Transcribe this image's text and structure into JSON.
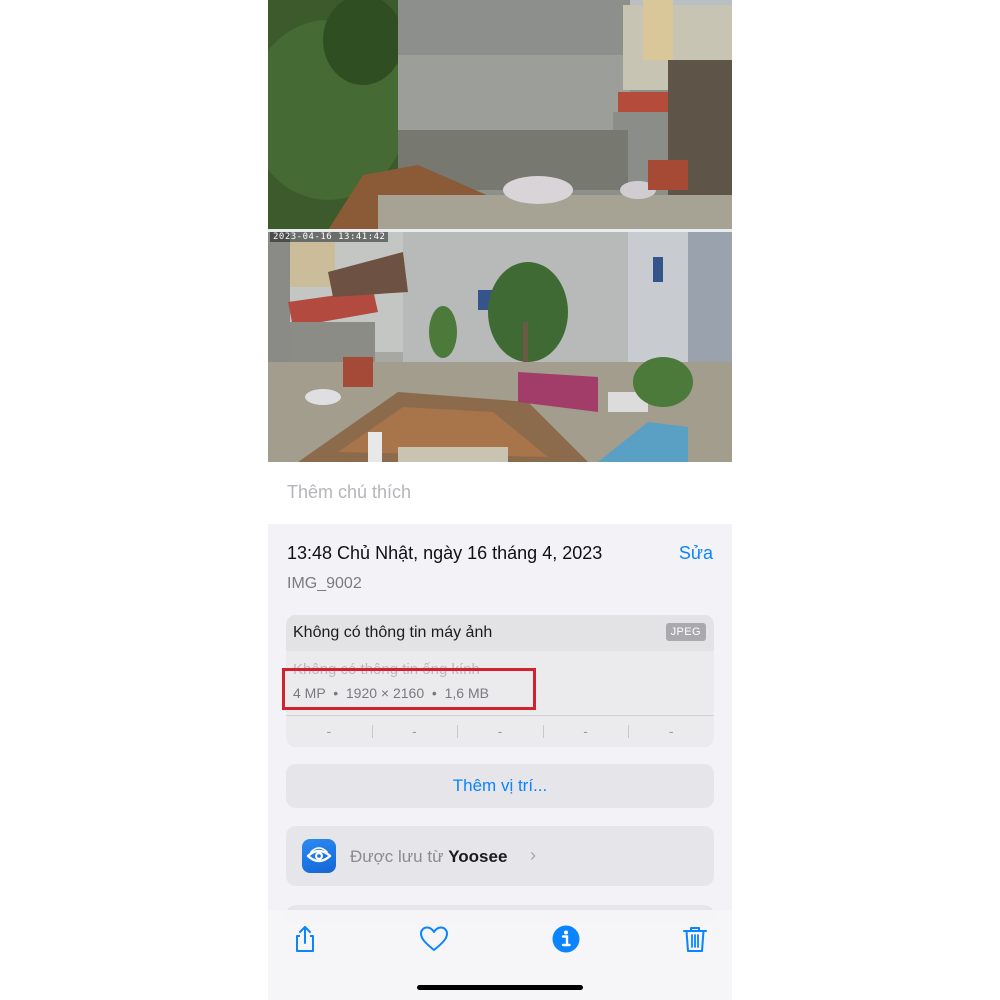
{
  "photo": {
    "camera_timestamp": "2023-04-16  13:41:42"
  },
  "caption": {
    "placeholder": "Thêm chú thích"
  },
  "info": {
    "datetime": "13:48 Chủ Nhật, ngày 16 tháng 4, 2023",
    "edit_label": "Sửa",
    "filename": "IMG_9002"
  },
  "metadata": {
    "camera": "Không có thông tin máy ảnh",
    "format": "JPEG",
    "lens": "Không có thông tin ống kính",
    "specs": "4 MP  •  1920 × 2160  •  1,6 MB",
    "exif": [
      "-",
      "-",
      "-",
      "-",
      "-"
    ]
  },
  "location": {
    "label": "Thêm vị trí..."
  },
  "source": {
    "prefix": "Được lưu từ",
    "app": "Yoosee",
    "chevron": "›",
    "icon": "yoosee-app-icon"
  },
  "toolbar": {
    "icons": [
      "share-icon",
      "heart-icon",
      "info-icon",
      "trash-icon"
    ]
  },
  "colors": {
    "accent": "#0a84ff",
    "highlight": "#d4212f",
    "background": "#f2f2f7"
  }
}
